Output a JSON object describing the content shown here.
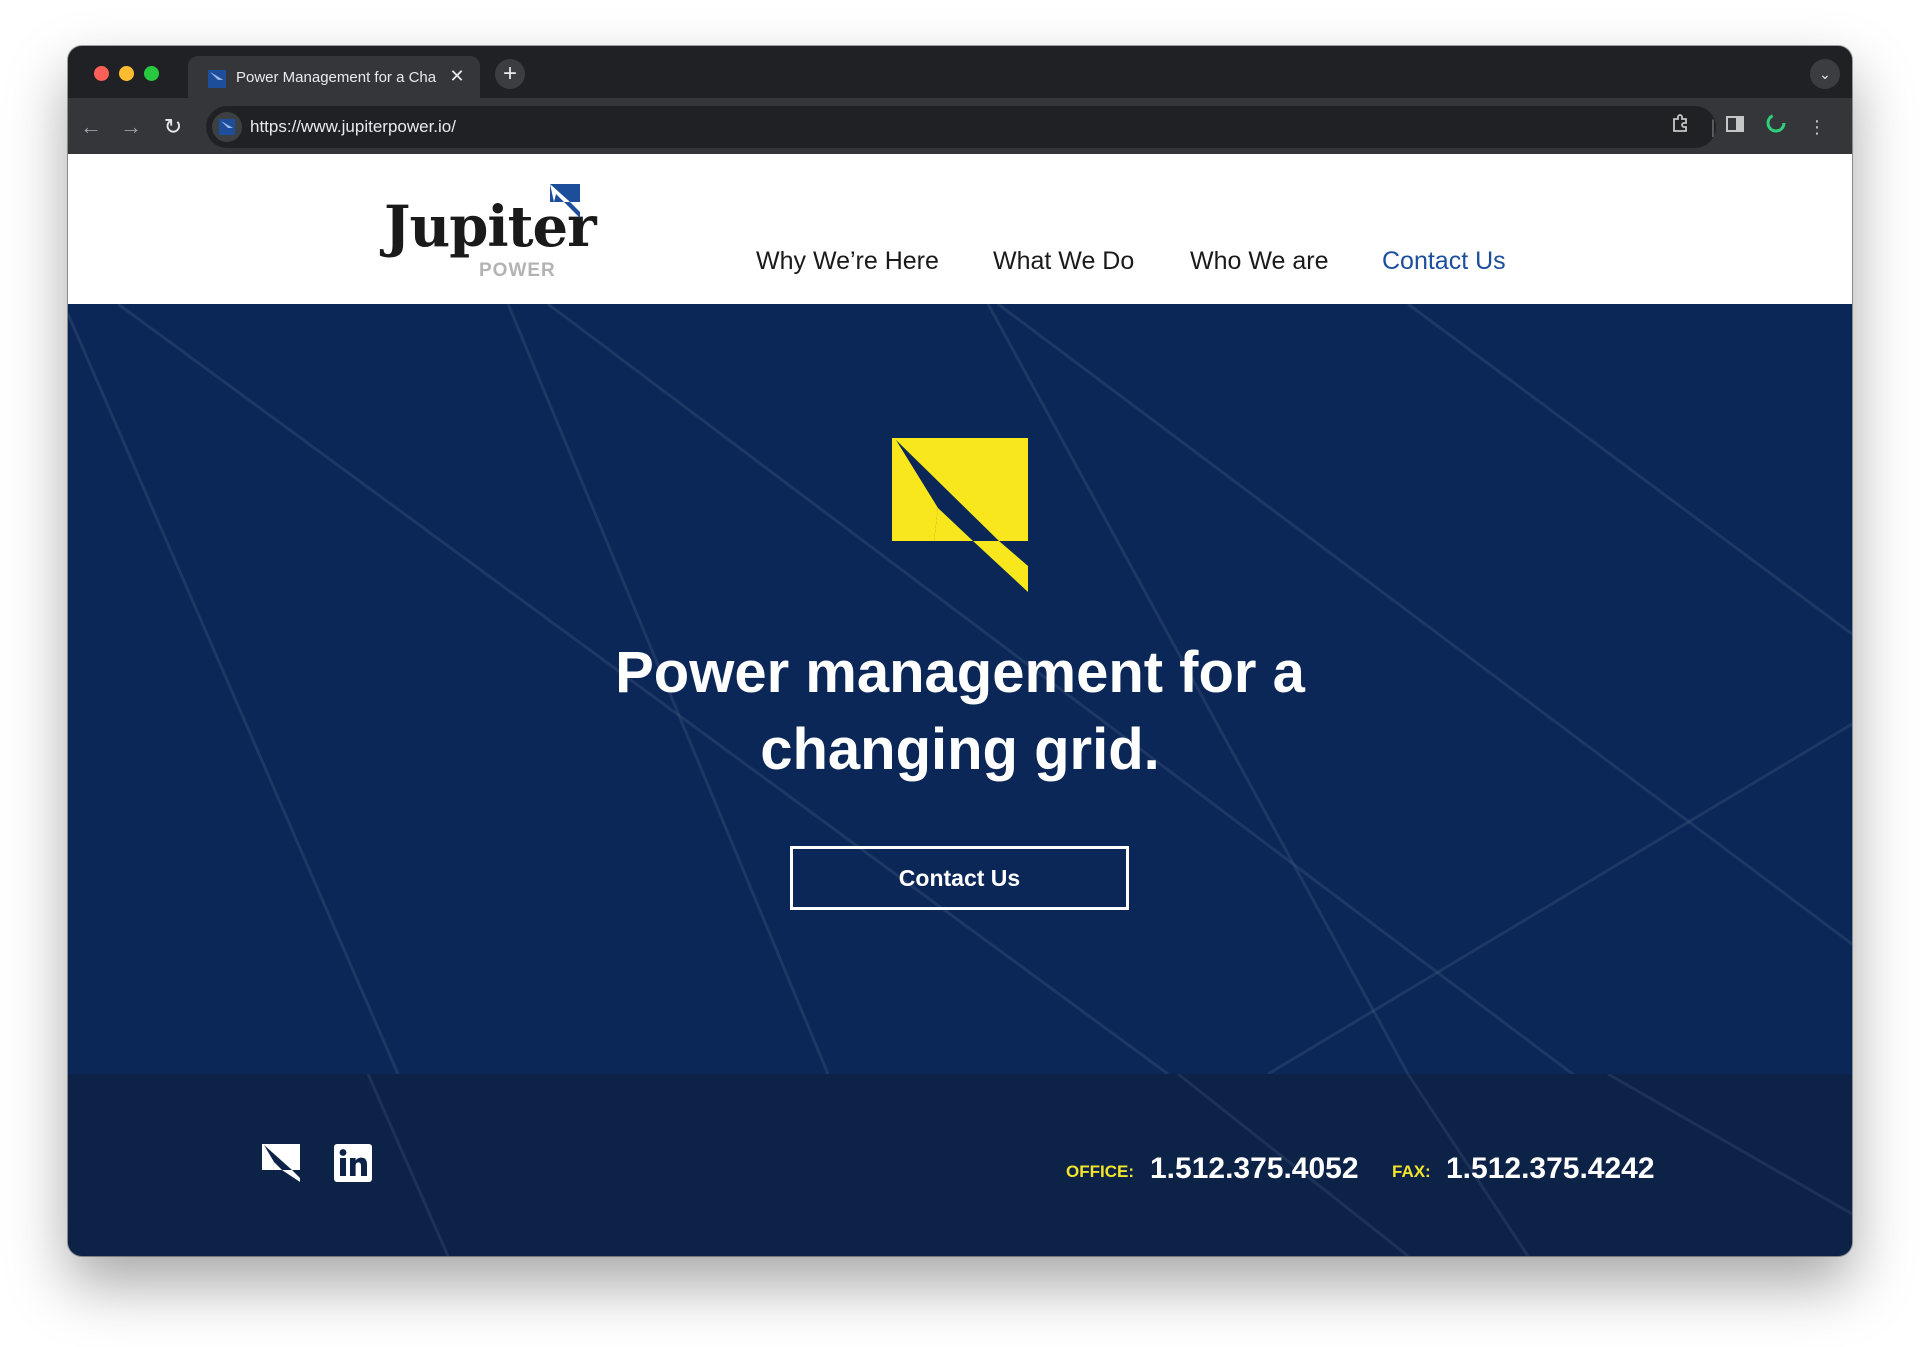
{
  "browser": {
    "tab_title": "Power Management for a Cha",
    "url": "https://www.jupiterpower.io/"
  },
  "site": {
    "logo_text": "Jupiter",
    "logo_subtext": "POWER",
    "nav": [
      {
        "label": "Why We’re Here"
      },
      {
        "label": "What We Do"
      },
      {
        "label": "Who We are"
      },
      {
        "label": "Contact Us",
        "active": true
      }
    ],
    "hero": {
      "title_line1": "Power management for a",
      "title_line2": "changing grid.",
      "cta_label": "Contact Us"
    },
    "footer": {
      "office_label": "OFFICE:",
      "office_number": "1.512.375.4052",
      "fax_label": "FAX:",
      "fax_number": "1.512.375.4242"
    }
  },
  "colors": {
    "navy": "#0b2757",
    "footer_navy": "#0d2247",
    "accent_yellow": "#f2e52a",
    "link_blue": "#1c4e9c"
  }
}
